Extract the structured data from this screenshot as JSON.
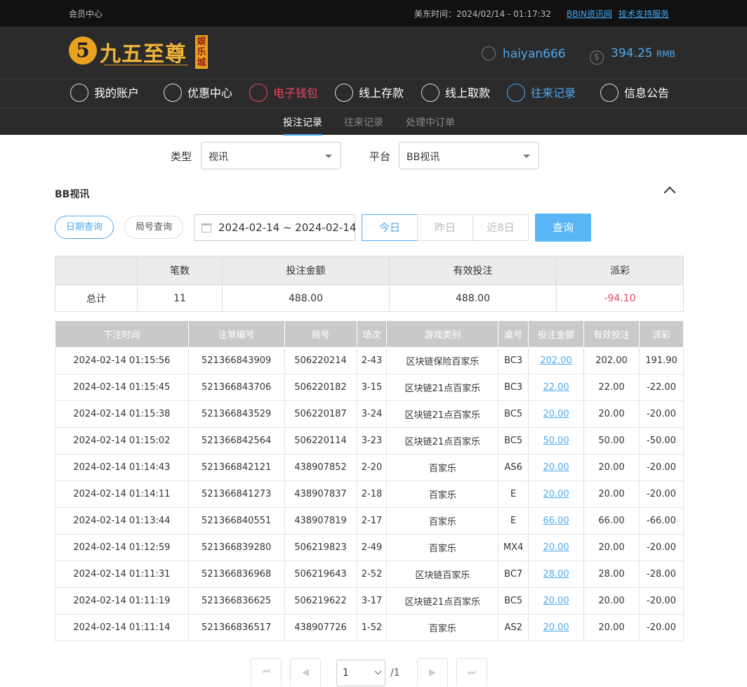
{
  "topbar": {
    "member_center": "会员中心",
    "time_label": "美东时间：2024/02/14 - 01:17:32",
    "link_bbin": "BBIN资讯网",
    "link_support": "技术支持服务"
  },
  "header": {
    "logo_glyph": "5",
    "logo_name": "九五至尊",
    "logo_tag": "娱乐城",
    "username": "haiyan666",
    "balance": "394.25",
    "currency": "RMB"
  },
  "nav": {
    "items": [
      {
        "label": "我的账户",
        "icon": "user-icon"
      },
      {
        "label": "优惠中心",
        "icon": "gift-icon"
      },
      {
        "label": "电子钱包",
        "icon": "wallet-icon"
      },
      {
        "label": "线上存款",
        "icon": "deposit-icon"
      },
      {
        "label": "线上取款",
        "icon": "withdraw-icon"
      },
      {
        "label": "往来记录",
        "icon": "records-icon"
      },
      {
        "label": "信息公告",
        "icon": "bell-icon"
      }
    ]
  },
  "subnav": {
    "tabs": [
      "投注记录",
      "往来记录",
      "处理中订单"
    ]
  },
  "filters": {
    "type_label": "类型",
    "type_value": "视讯",
    "platform_label": "平台",
    "platform_value": "BB视讯"
  },
  "section": {
    "title": "BB视讯",
    "btn_date_query": "日期查询",
    "btn_round_query": "局号查询",
    "date_range": "2024-02-14 ~ 2024-02-14",
    "seg_today": "今日",
    "seg_yesterday": "昨日",
    "seg_8days": "近8日",
    "query_button": "查询"
  },
  "summary": {
    "headers": [
      "",
      "笔数",
      "投注金额",
      "有效投注",
      "派彩"
    ],
    "row": [
      "总计",
      "11",
      "488.00",
      "488.00",
      "-94.10"
    ]
  },
  "records": {
    "headers": [
      "下注时间",
      "注单编号",
      "局号",
      "场次",
      "游戏类别",
      "桌号",
      "投注金额",
      "有效投注",
      "派彩"
    ],
    "rows": [
      [
        "2024-02-14 01:15:56",
        "521366843909",
        "506220214",
        "2-43",
        "区块链保险百家乐",
        "BC3",
        "202.00",
        "202.00",
        "191.90"
      ],
      [
        "2024-02-14 01:15:45",
        "521366843706",
        "506220182",
        "3-15",
        "区块链21点百家乐",
        "BC3",
        "22.00",
        "22.00",
        "-22.00"
      ],
      [
        "2024-02-14 01:15:38",
        "521366843529",
        "506220187",
        "3-24",
        "区块链21点百家乐",
        "BC5",
        "20.00",
        "20.00",
        "-20.00"
      ],
      [
        "2024-02-14 01:15:02",
        "521366842564",
        "506220114",
        "3-23",
        "区块链21点百家乐",
        "BC5",
        "50.00",
        "50.00",
        "-50.00"
      ],
      [
        "2024-02-14 01:14:43",
        "521366842121",
        "438907852",
        "2-20",
        "百家乐",
        "AS6",
        "20.00",
        "20.00",
        "-20.00"
      ],
      [
        "2024-02-14 01:14:11",
        "521366841273",
        "438907837",
        "2-18",
        "百家乐",
        "E",
        "20.00",
        "20.00",
        "-20.00"
      ],
      [
        "2024-02-14 01:13:44",
        "521366840551",
        "438907819",
        "2-17",
        "百家乐",
        "E",
        "66.00",
        "66.00",
        "-66.00"
      ],
      [
        "2024-02-14 01:12:59",
        "521366839280",
        "506219823",
        "2-49",
        "百家乐",
        "MX4",
        "20.00",
        "20.00",
        "-20.00"
      ],
      [
        "2024-02-14 01:11:31",
        "521366836968",
        "506219643",
        "2-52",
        "区块链百家乐",
        "BC7",
        "28.00",
        "28.00",
        "-28.00"
      ],
      [
        "2024-02-14 01:11:19",
        "521366836625",
        "506219622",
        "3-17",
        "区块链21点百家乐",
        "BC5",
        "20.00",
        "20.00",
        "-20.00"
      ],
      [
        "2024-02-14 01:11:14",
        "521366836517",
        "438907726",
        "1-52",
        "百家乐",
        "AS2",
        "20.00",
        "20.00",
        "-20.00"
      ]
    ]
  },
  "pager": {
    "first": "⏮",
    "prev": "◀",
    "next": "▶",
    "last": "⏭",
    "page": "1",
    "total": "/1"
  }
}
